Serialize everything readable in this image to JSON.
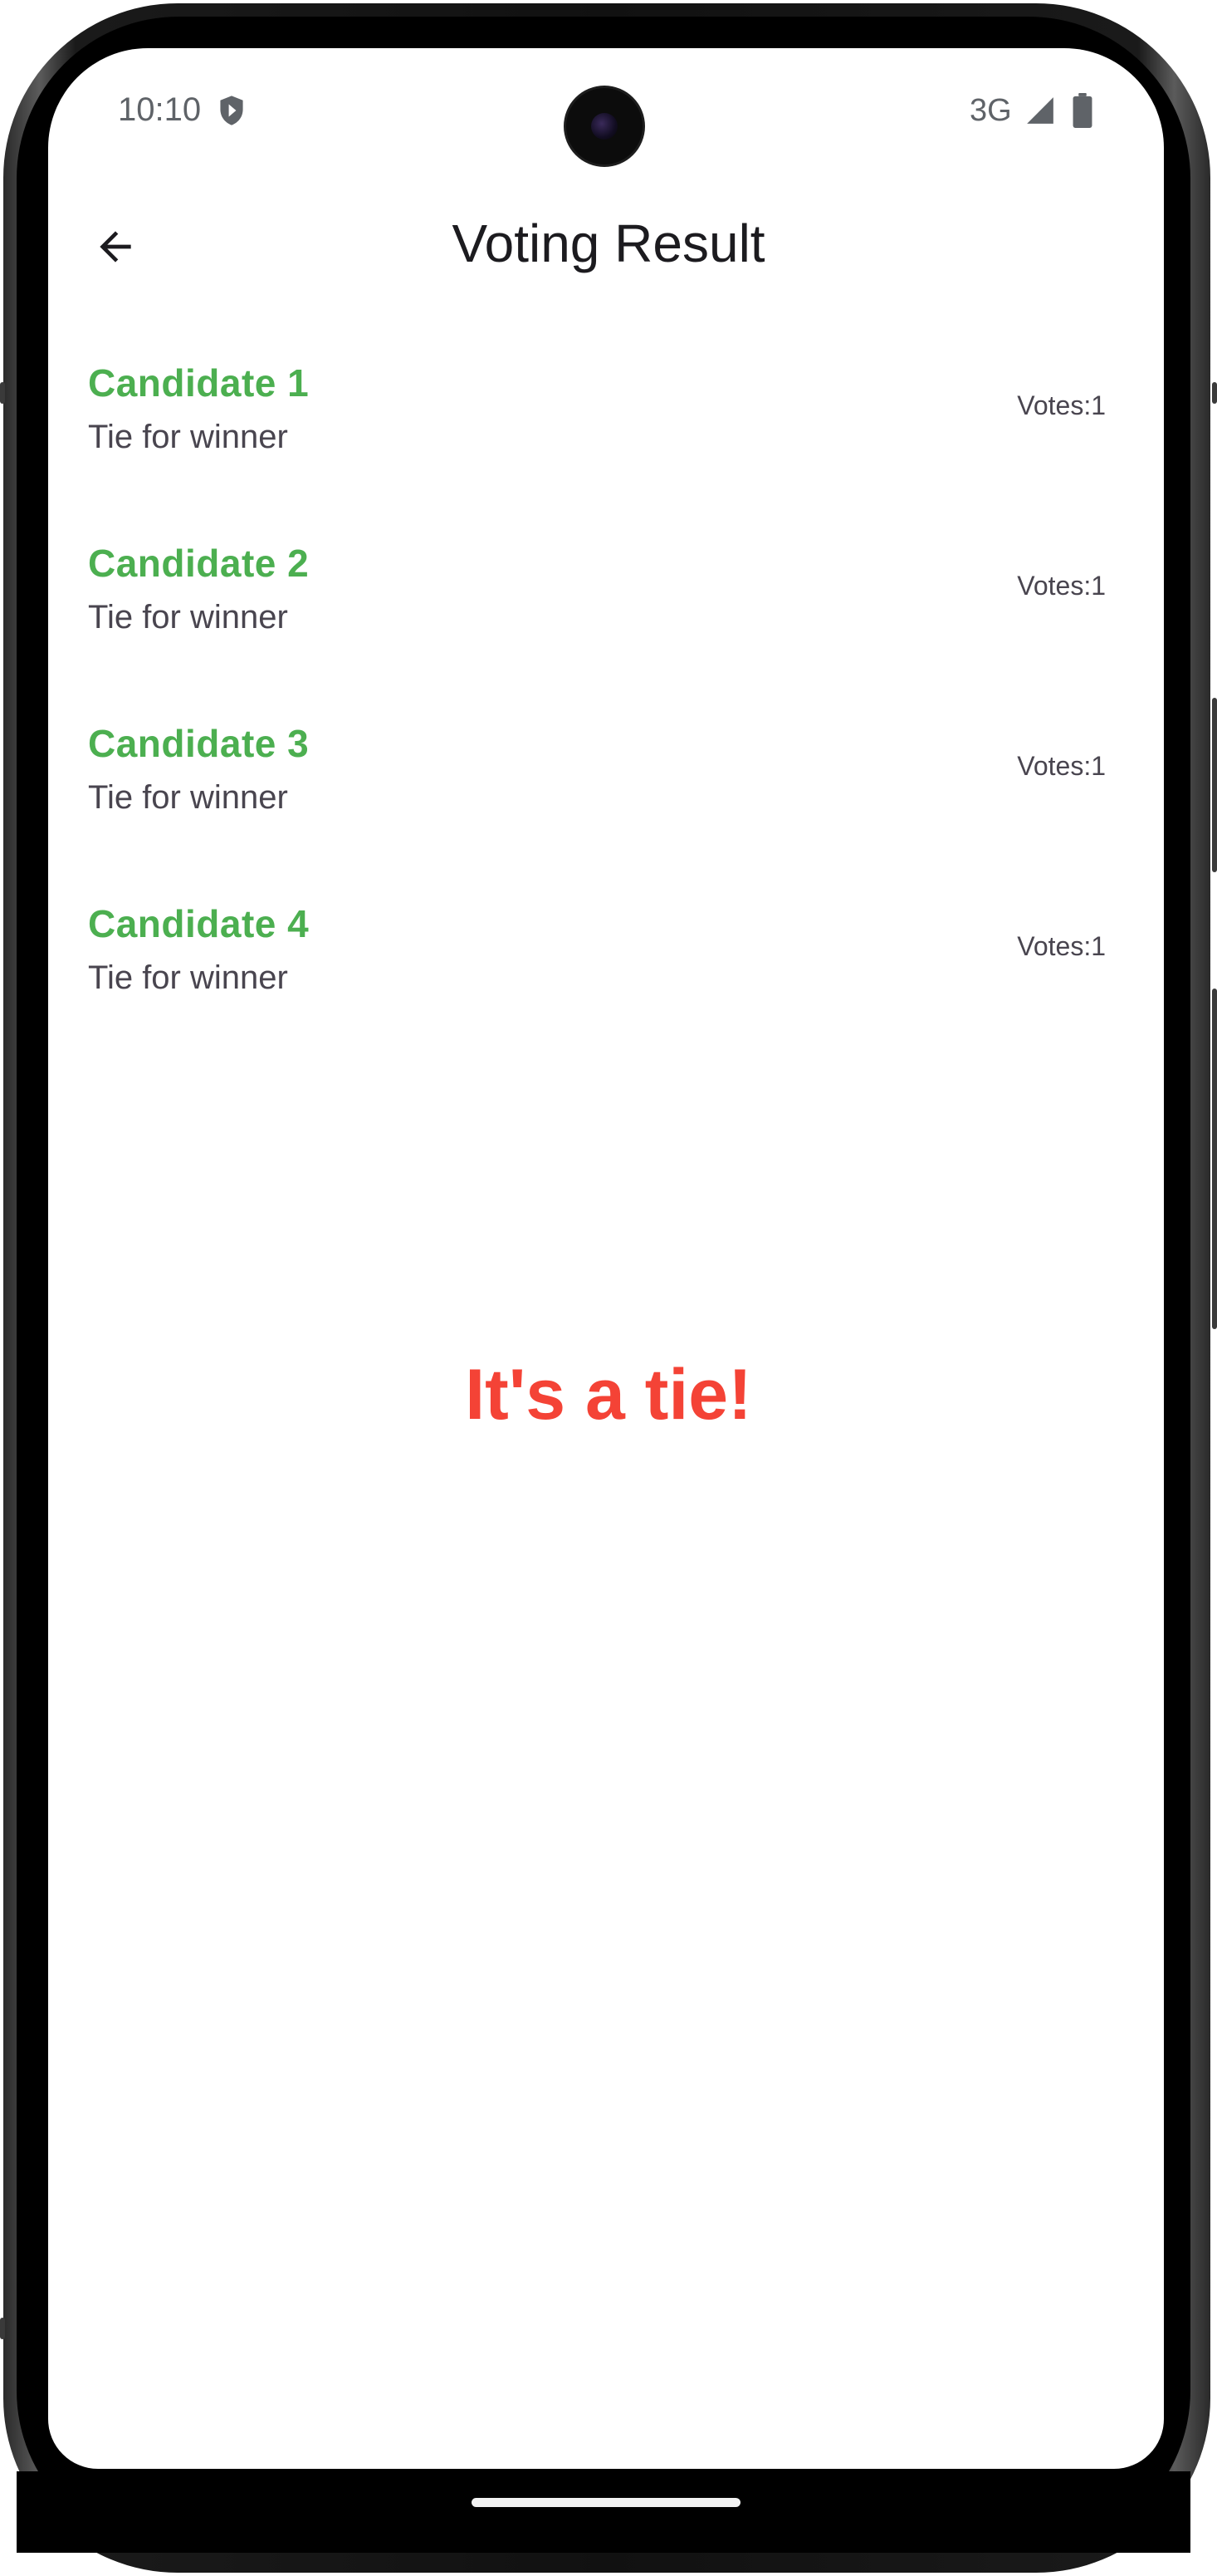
{
  "status_bar": {
    "time": "10:10",
    "network": "3G",
    "icons": [
      "shield-icon",
      "signal-icon",
      "battery-icon"
    ]
  },
  "app_bar": {
    "back_icon": "arrow-back-icon",
    "title": "Voting Result"
  },
  "candidates": [
    {
      "name": "Candidate 1",
      "status": "Tie for winner",
      "votes": "Votes:1"
    },
    {
      "name": "Candidate 2",
      "status": "Tie for winner",
      "votes": "Votes:1"
    },
    {
      "name": "Candidate 3",
      "status": "Tie for winner",
      "votes": "Votes:1"
    },
    {
      "name": "Candidate 4",
      "status": "Tie for winner",
      "votes": "Votes:1"
    }
  ],
  "result": {
    "message": "It's a tie!"
  },
  "colors": {
    "candidate_name": "#4caf50",
    "result_message": "#f44336",
    "title": "#1c1b1f",
    "secondary_text": "#49454f"
  }
}
